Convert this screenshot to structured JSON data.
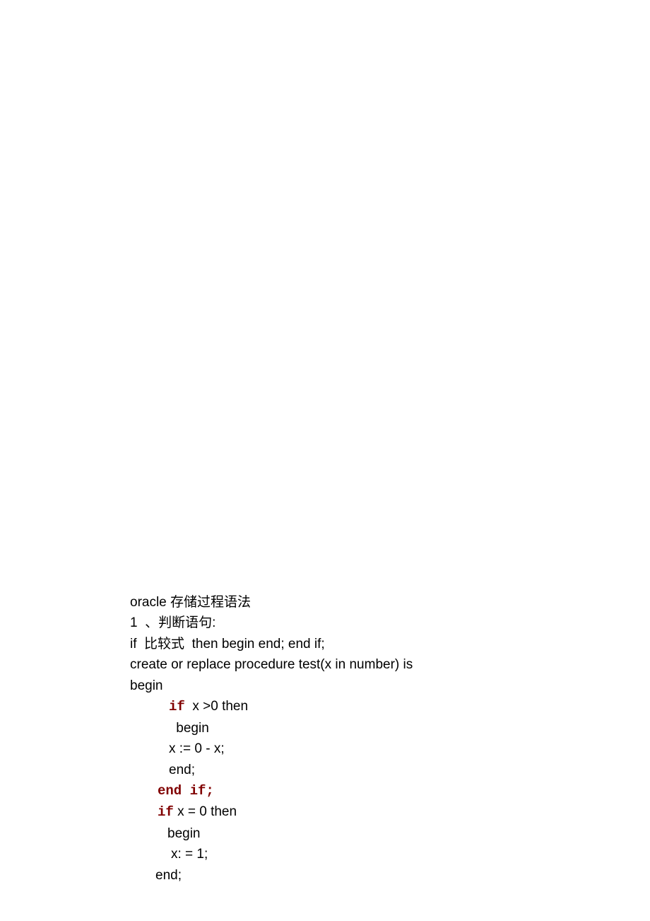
{
  "doc": {
    "title": "oracle 存储过程语法",
    "section": "1  、判断语句:",
    "template": "if  比较式  then begin end; end if;",
    "proc": "create or replace procedure test(x in number) is",
    "begin": "begin",
    "if1": "if",
    "if1_cond": "  x >0 then",
    "begin2": " begin",
    "assign1": "x := 0 - x;",
    "end2": "end;",
    "endif": "end if;",
    "if2": "if",
    "if2_cond": " x = 0 then",
    "begin3": "begin",
    "assign2": "x: = 1;",
    "end3": "end;"
  }
}
